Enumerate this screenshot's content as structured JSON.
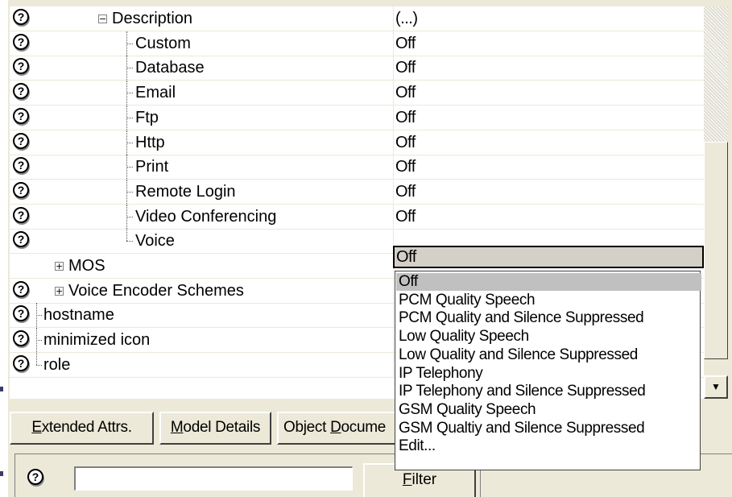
{
  "help_glyph": "?",
  "rows": [
    {
      "name": "Description",
      "value": "(...)",
      "kind": "node-expanded"
    },
    {
      "name": "Custom",
      "value": "Off",
      "kind": "child"
    },
    {
      "name": "Database",
      "value": "Off",
      "kind": "child"
    },
    {
      "name": "Email",
      "value": "Off",
      "kind": "child"
    },
    {
      "name": "Ftp",
      "value": "Off",
      "kind": "child"
    },
    {
      "name": "Http",
      "value": "Off",
      "kind": "child"
    },
    {
      "name": "Print",
      "value": "Off",
      "kind": "child"
    },
    {
      "name": "Remote Login",
      "value": "Off",
      "kind": "child"
    },
    {
      "name": "Video Conferencing",
      "value": "Off",
      "kind": "child"
    },
    {
      "name": "Voice",
      "value": "Off",
      "kind": "child-last-selected"
    },
    {
      "name": "MOS",
      "value": "",
      "kind": "node-collapsed-nohelp"
    },
    {
      "name": "Voice Encoder Schemes",
      "value": "",
      "kind": "node-collapsed"
    },
    {
      "name": "hostname",
      "value": "",
      "kind": "root-child"
    },
    {
      "name": "minimized icon",
      "value": "",
      "kind": "root-child"
    },
    {
      "name": "role",
      "value": "",
      "kind": "root-child-last"
    }
  ],
  "dropdown": {
    "options": [
      "Off",
      "PCM Quality Speech",
      "PCM Quality and Silence Suppressed",
      "Low Quality Speech",
      "Low Quality and Silence Suppressed",
      "IP Telephony",
      "IP Telephony and Silence Suppressed",
      "GSM Quality Speech",
      "GSM Qualtiy and Silence Suppressed",
      "Edit..."
    ],
    "selected_index": 0
  },
  "buttons": {
    "extended_attrs": {
      "mnemonic": "E",
      "rest": "xtended Attrs."
    },
    "model_details": {
      "mnemonic": "M",
      "rest": "odel Details"
    },
    "object_docs": {
      "prefix": "Object ",
      "mnemonic": "D",
      "rest": "ocume"
    },
    "filter": {
      "mnemonic": "F",
      "rest": "ilter"
    }
  },
  "filter_input": {
    "value": ""
  }
}
